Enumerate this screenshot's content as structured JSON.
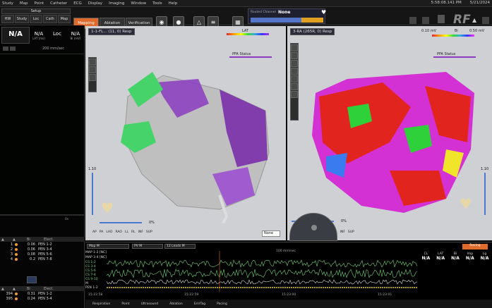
{
  "menu": [
    "Study",
    "Map",
    "Point",
    "Catheter",
    "ECG",
    "Display",
    "Imaging",
    "Window",
    "Tools",
    "Help"
  ],
  "clock": {
    "time": "5:58:08.141 PM",
    "date": "5/21/2024"
  },
  "toolbar": {
    "setup_label": "Setup",
    "sub_tabs": [
      "HW",
      "Study",
      "Loc",
      "Cath",
      "Map"
    ],
    "modes": [
      "Mapping",
      "Ablation",
      "Verification"
    ],
    "routed_label": "Routed Channel",
    "routed_value": "None",
    "brand": "RF"
  },
  "left_panel": {
    "values": [
      "N/A",
      "N/A",
      "Loc",
      "N/A"
    ],
    "labels": [
      "",
      "LAT (ms)",
      "",
      "Bi (mV)"
    ],
    "speed": "200 mm/sec",
    "ruler_label": "0s",
    "table1": {
      "headers": [
        "Bi",
        "Elect."
      ],
      "rows": [
        [
          "1",
          "0.06",
          "PEN 1-2"
        ],
        [
          "2",
          "0.06",
          "PEN 3-4"
        ],
        [
          "3",
          "0.08",
          "PEN 5-6"
        ],
        [
          "4",
          "0.2",
          "PEN 7-8"
        ]
      ]
    },
    "table2": {
      "headers": [
        "Bi",
        "Elect."
      ],
      "rows": [
        [
          "394",
          "0.31",
          "PEN 1-2"
        ],
        [
          "395",
          "0.24",
          "PEN 3-4"
        ]
      ]
    }
  },
  "view1": {
    "title": "1-1-FL... (11, 0) Resp",
    "legend": "LAT",
    "status": "PFA Status",
    "scale": "1.10",
    "zoom": "0%",
    "orient": [
      "AP",
      "PA",
      "LAO",
      "RAO",
      "LL",
      "RL",
      "INF",
      "SUP"
    ],
    "dropdown": "None"
  },
  "view2": {
    "title": "3-RA (265R, 0) Resp",
    "legend": "Bi",
    "legend_min": "0.10 mV",
    "legend_max": "0.50 mV",
    "status": "PFA Status",
    "scale": "1.10",
    "zoom": "0%",
    "orient": [
      "AP",
      "PA",
      "LAO",
      "RAO",
      "LL",
      "RL",
      "INF",
      "SUP"
    ]
  },
  "signals": {
    "selectors": [
      "Map M",
      "PV M",
      "12 Leads M"
    ],
    "labels": [
      "MAP 1-2 [NC]",
      "MAP 3-4 [NC]",
      "CS 1-2",
      "CS 3-4",
      "CS 5-6",
      "CS 7-8",
      "CS 9-10",
      "M",
      "PEN 1-2"
    ],
    "speed": "100 mm/sec",
    "times": [
      "15:22:58",
      "15:22:59",
      "15:23:00",
      "15:23:01"
    ],
    "readout_heads": [
      "CL",
      "LAT",
      "Bi",
      "Imp",
      "Lg"
    ],
    "readout_vals": [
      "N/A",
      "N/A",
      "N/A",
      "N/A",
      "N/A"
    ],
    "button": "Roving"
  },
  "bottom": [
    "Respiration",
    "Point",
    "Ultrasound",
    "Ablation",
    "EnVTag",
    "Pacing"
  ],
  "colors": {
    "accent": "#e06a2b",
    "green": "#7ad17a",
    "purple": "#8a3bbf"
  }
}
